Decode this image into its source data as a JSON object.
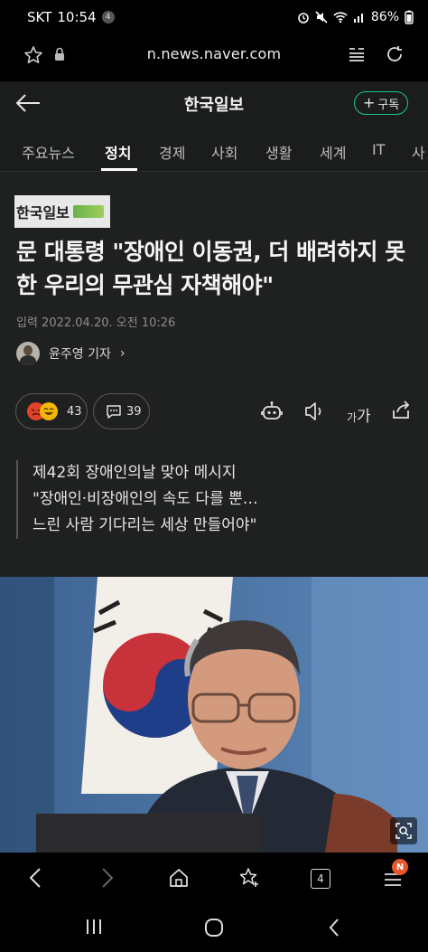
{
  "status_bar": {
    "carrier": "SKT",
    "time": "10:54",
    "notification_count": "4",
    "battery": "86%"
  },
  "browser": {
    "url": "n.news.naver.com",
    "tab_count": "4",
    "menu_badge": "N"
  },
  "news_header": {
    "title": "한국일보",
    "subscribe_label": "구독",
    "subscribe_plus": "+"
  },
  "tabs": [
    {
      "label": "주요뉴스",
      "active": false
    },
    {
      "label": "정치",
      "active": true
    },
    {
      "label": "경제",
      "active": false
    },
    {
      "label": "사회",
      "active": false
    },
    {
      "label": "생활",
      "active": false
    },
    {
      "label": "세계",
      "active": false
    },
    {
      "label": "IT",
      "active": false
    },
    {
      "label": "사",
      "active": false
    }
  ],
  "article": {
    "press_name": "한국일보",
    "headline": "문 대통령 \"장애인 이동권, 더 배려하지 못한 우리의 무관심 자책해야\"",
    "date": "입력 2022.04.20. 오전 10:26",
    "reporter": "윤주영 기자",
    "reporter_chevron": "›",
    "reaction_count": "43",
    "comment_count": "39",
    "font_size_label_small": "가",
    "font_size_label_large": "가",
    "quote_lines": [
      "제42회 장애인의날 맞아 메시지",
      "\"장애인·비장애인의 속도 다를 뿐…",
      "느린 사람 기다리는 세상 만들어야\""
    ]
  },
  "colors": {
    "accent": "#1ec68a",
    "header_bg": "#1a1d1c",
    "article_bg": "#1f2020"
  },
  "icons": [
    "star-icon",
    "lock-icon",
    "reader-mode-icon",
    "reload-icon",
    "back-arrow-icon",
    "angry-emoji-icon",
    "laugh-emoji-icon",
    "comment-icon",
    "robot-summary-icon",
    "speaker-icon",
    "share-icon",
    "zoom-icon",
    "chevron-left-icon",
    "chevron-right-icon",
    "home-icon",
    "bookmark-icon",
    "tabs-icon",
    "menu-icon",
    "recents-icon",
    "home-circle-icon",
    "system-back-icon"
  ]
}
